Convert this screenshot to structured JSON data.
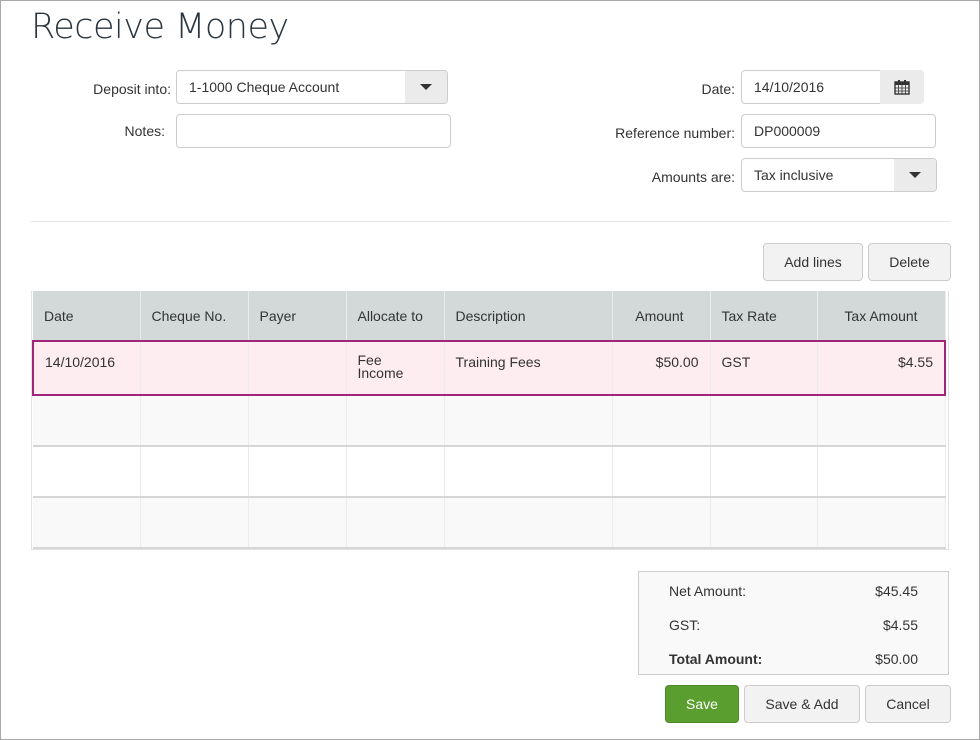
{
  "page": {
    "title": "Receive Money"
  },
  "form": {
    "deposit_into": {
      "label": "Deposit into:",
      "value": "1-1000 Cheque Account"
    },
    "notes": {
      "label": "Notes:",
      "value": ""
    },
    "date": {
      "label": "Date:",
      "value": "14/10/2016"
    },
    "reference": {
      "label": "Reference number:",
      "value": "DP000009"
    },
    "amounts_are": {
      "label": "Amounts are:",
      "value": "Tax inclusive"
    }
  },
  "toolbar": {
    "add_lines": "Add lines",
    "delete": "Delete"
  },
  "table": {
    "columns": [
      "Date",
      "Cheque No.",
      "Payer",
      "Allocate to",
      "Description",
      "Amount",
      "Tax Rate",
      "Tax Amount"
    ],
    "rows": [
      {
        "date": "14/10/2016",
        "cheque_no": "",
        "payer": "",
        "allocate_to": "Fee Income",
        "description": "Training Fees",
        "amount": "$50.00",
        "tax_rate": "GST",
        "tax_amount": "$4.55"
      }
    ],
    "empty_rows": 3
  },
  "totals": {
    "net_label": "Net Amount:",
    "net_value": "$45.45",
    "tax_label": "GST:",
    "tax_value": "$4.55",
    "total_label": "Total Amount:",
    "total_value": "$50.00"
  },
  "actions": {
    "save": "Save",
    "save_add": "Save & Add",
    "cancel": "Cancel"
  },
  "colors": {
    "accent_selected_row": "#a0267a",
    "primary_button": "#5a9e2f"
  }
}
